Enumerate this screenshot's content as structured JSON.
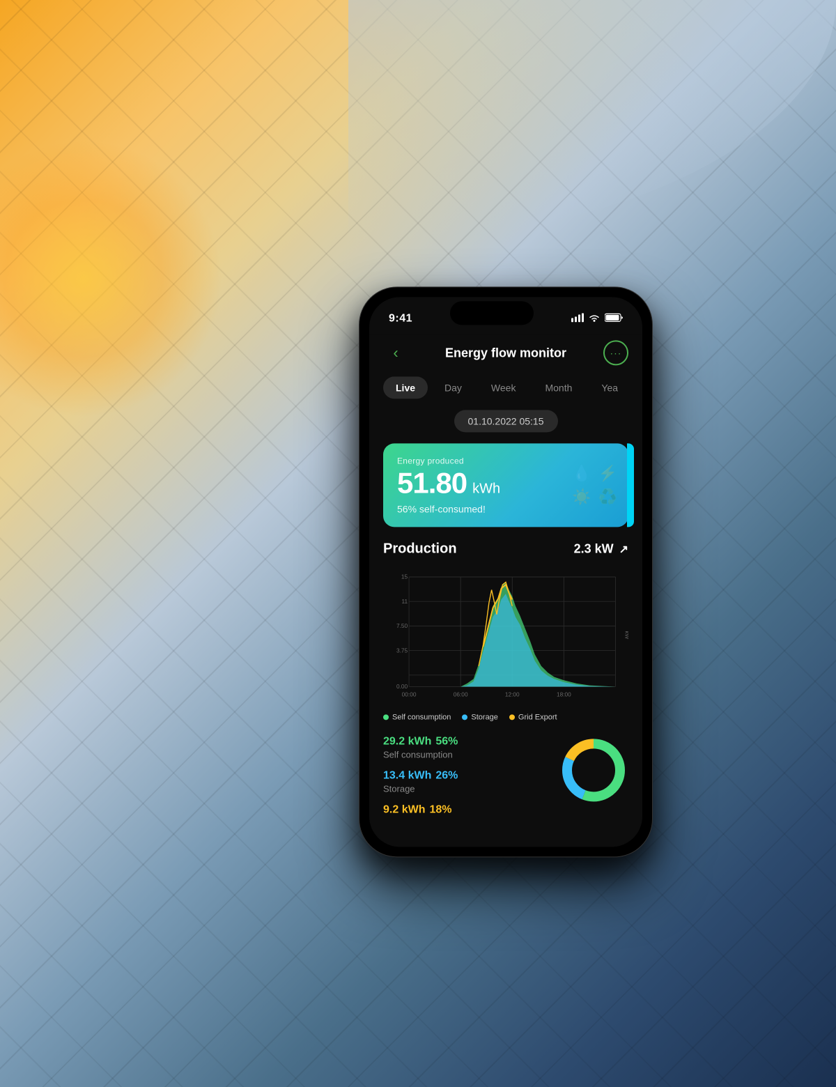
{
  "background": {
    "description": "Solar panels with sky background"
  },
  "phone": {
    "status_bar": {
      "time": "9:41",
      "signal": "▐▐▐",
      "wifi": "WiFi",
      "battery": "Battery"
    },
    "header": {
      "back_label": "‹",
      "title": "Energy flow monitor",
      "more_label": "···"
    },
    "tabs": [
      {
        "id": "live",
        "label": "Live",
        "active": true
      },
      {
        "id": "day",
        "label": "Day",
        "active": false
      },
      {
        "id": "week",
        "label": "Week",
        "active": false
      },
      {
        "id": "month",
        "label": "Month",
        "active": false
      },
      {
        "id": "year",
        "label": "Yea",
        "active": false
      }
    ],
    "date": "01.10.2022 05:15",
    "energy_card": {
      "label": "Energy produced",
      "value": "51.80",
      "unit": "kWh",
      "sub": "56% self-consumed!"
    },
    "production": {
      "title": "Production",
      "value": "2.3 kW",
      "chart": {
        "x_labels": [
          "00:00",
          "06:00",
          "12:00",
          "18:00"
        ],
        "y_labels": [
          "15",
          "11",
          "7.50",
          "3.75",
          "0.00"
        ],
        "y_axis_label": "kW",
        "series": {
          "self_consumption": {
            "color": "#4ade80",
            "label": "Self consumption"
          },
          "storage": {
            "color": "#38bdf8",
            "label": "Storage"
          },
          "grid_export": {
            "color": "#fbbf24",
            "label": "Grid Export"
          }
        }
      }
    },
    "stats": [
      {
        "kwh": "29.2 kWh",
        "pct": "56%",
        "label": "Self consumption",
        "color": "green"
      },
      {
        "kwh": "13.4 kWh",
        "pct": "26%",
        "label": "Storage",
        "color": "blue"
      },
      {
        "kwh": "9.2 kWh",
        "pct": "18%",
        "label": "",
        "color": "yellow"
      }
    ],
    "donut": {
      "segments": [
        {
          "value": 56,
          "color": "#4ade80"
        },
        {
          "value": 26,
          "color": "#38bdf8"
        },
        {
          "value": 18,
          "color": "#fbbf24"
        }
      ]
    }
  }
}
